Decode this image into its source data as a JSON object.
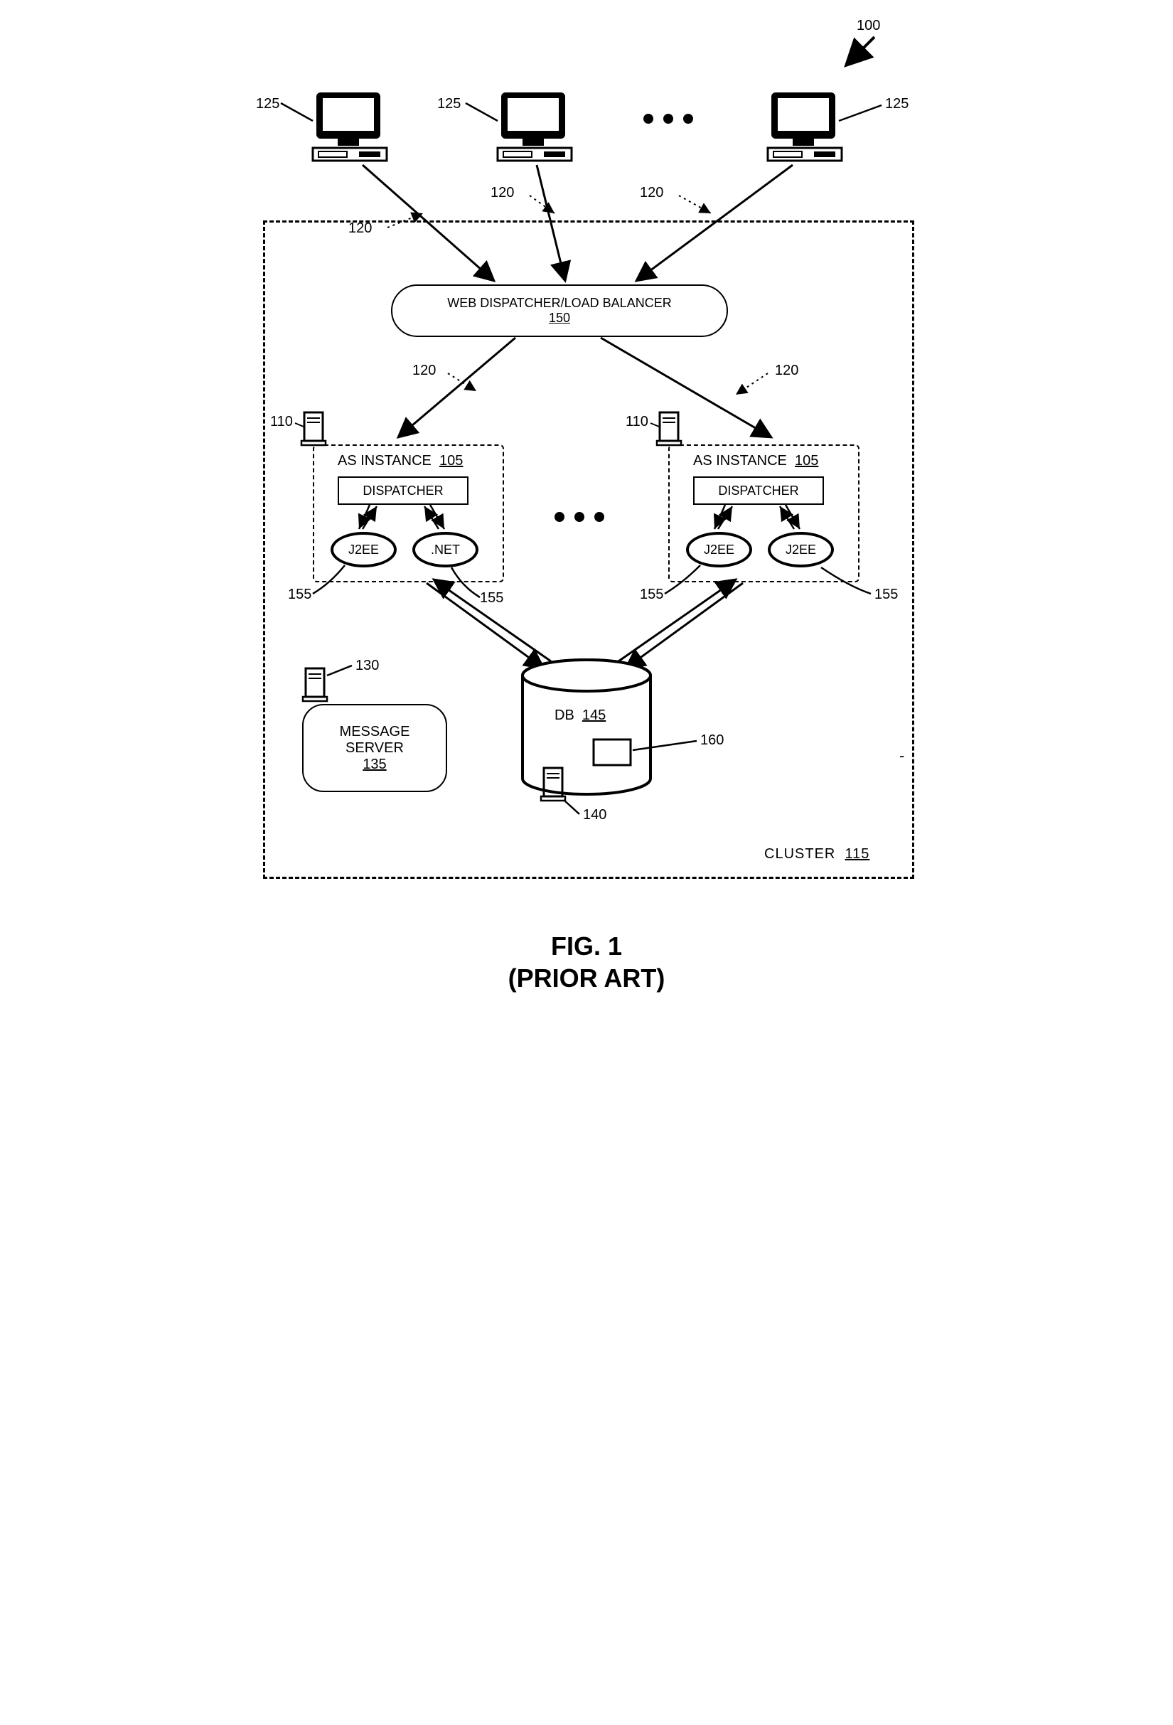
{
  "ref": {
    "system": "100",
    "client": "125",
    "request": "120",
    "cluster": "115",
    "clusterLabel": "CLUSTER",
    "loadBalancer": {
      "title": "WEB DISPATCHER/LOAD BALANCER",
      "num": "150"
    },
    "asHost": "110",
    "asInstance": {
      "title": "AS INSTANCE",
      "num": "105"
    },
    "dispatcher": "DISPATCHER",
    "nodeA": "J2EE",
    "nodeB_left": ".NET",
    "nodeB_right": "J2EE",
    "nodeRef": "155",
    "msgServerHost": "130",
    "msgServer": {
      "title": "MESSAGE\nSERVER",
      "num": "135"
    },
    "dbHost": "140",
    "db": {
      "title": "DB",
      "num": "145"
    },
    "dbInner": "160"
  },
  "caption": {
    "line1": "FIG. 1",
    "line2": "(PRIOR ART)"
  }
}
